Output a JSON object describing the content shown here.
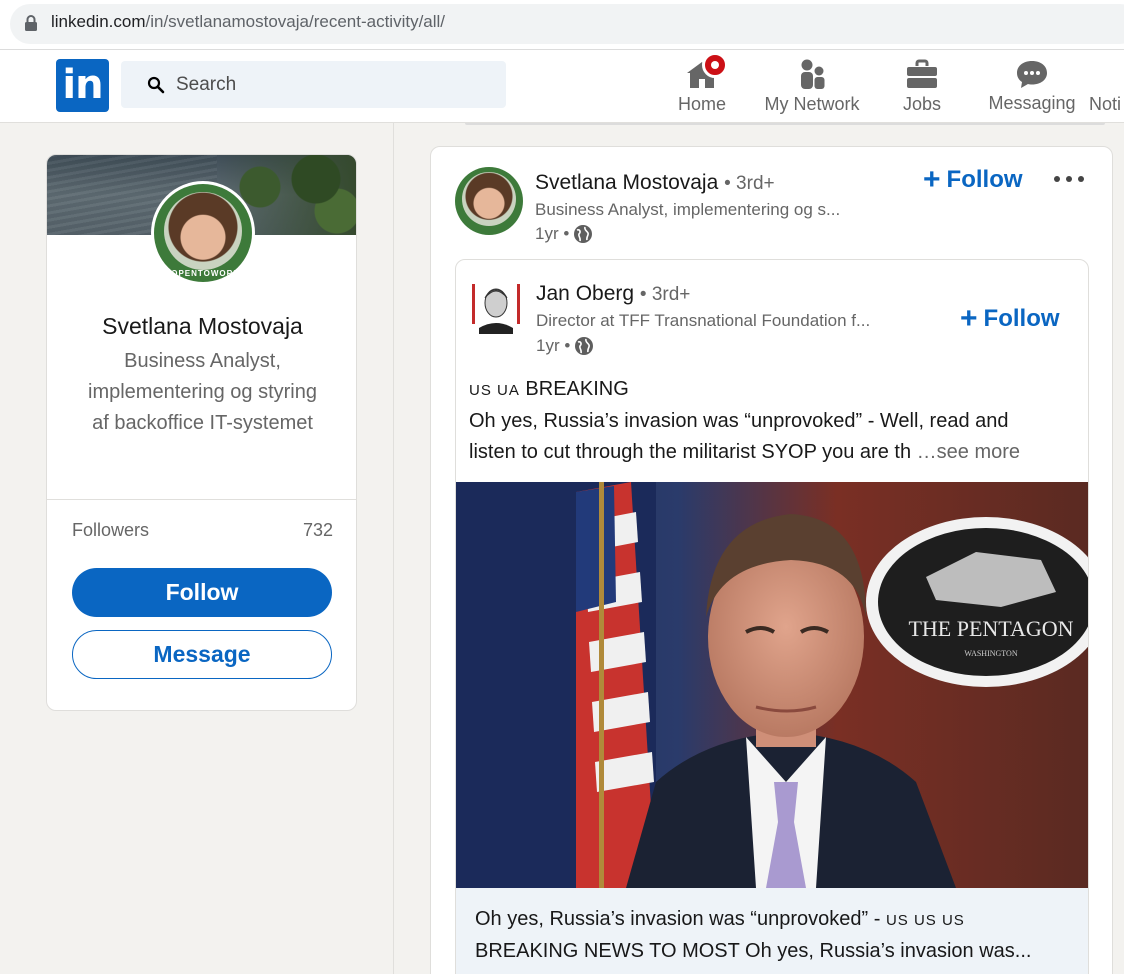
{
  "browser": {
    "url_domain": "linkedin.com",
    "url_path": "/in/svetlanamostovaja/recent-activity/all/"
  },
  "nav": {
    "logo_text": "in",
    "search_placeholder": "Search",
    "items": [
      {
        "label": "Home",
        "icon": "home-icon",
        "badge": true
      },
      {
        "label": "My Network",
        "icon": "network-icon"
      },
      {
        "label": "Jobs",
        "icon": "briefcase-icon"
      },
      {
        "label": "Messaging",
        "icon": "messaging-icon"
      },
      {
        "label": "Noti",
        "icon": "bell-icon"
      }
    ]
  },
  "profile": {
    "name": "Svetlana Mostovaja",
    "headline": "Business Analyst, implementering og styring af backoffice IT-systemet",
    "frame_label": "#OPENTOWORK",
    "followers_label": "Followers",
    "followers_count": "732",
    "follow_button": "Follow",
    "message_button": "Message"
  },
  "post": {
    "author": "Svetlana Mostovaja",
    "degree": "• 3rd+",
    "headline": "Business Analyst, implementering og s...",
    "time": "1yr •",
    "follow_label": "Follow",
    "reshared": {
      "author": "Jan Oberg",
      "degree": "• 3rd+",
      "headline": "Director at TFF Transnational Foundation f...",
      "time": "1yr •",
      "follow_label": "Follow",
      "flags": "US UA",
      "line1": "BREAKING",
      "line2": "Oh yes, Russia’s invasion was “unprovoked” - Well, read and",
      "line3": "listen to cut through the militarist SYOP you are th",
      "see_more": "…see more",
      "image_sign": "THE PENTAGON",
      "image_sign_sub": "WASHINGTON",
      "caption_part1": "Oh yes, Russia’s invasion was “unprovoked” -",
      "caption_flags": "US US US",
      "caption_part2": "BREAKING NEWS TO MOST Oh yes, Russia’s invasion was..."
    }
  },
  "colors": {
    "brand": "#0a66c2",
    "badge": "#cc1016",
    "background": "#f3f2ef"
  }
}
